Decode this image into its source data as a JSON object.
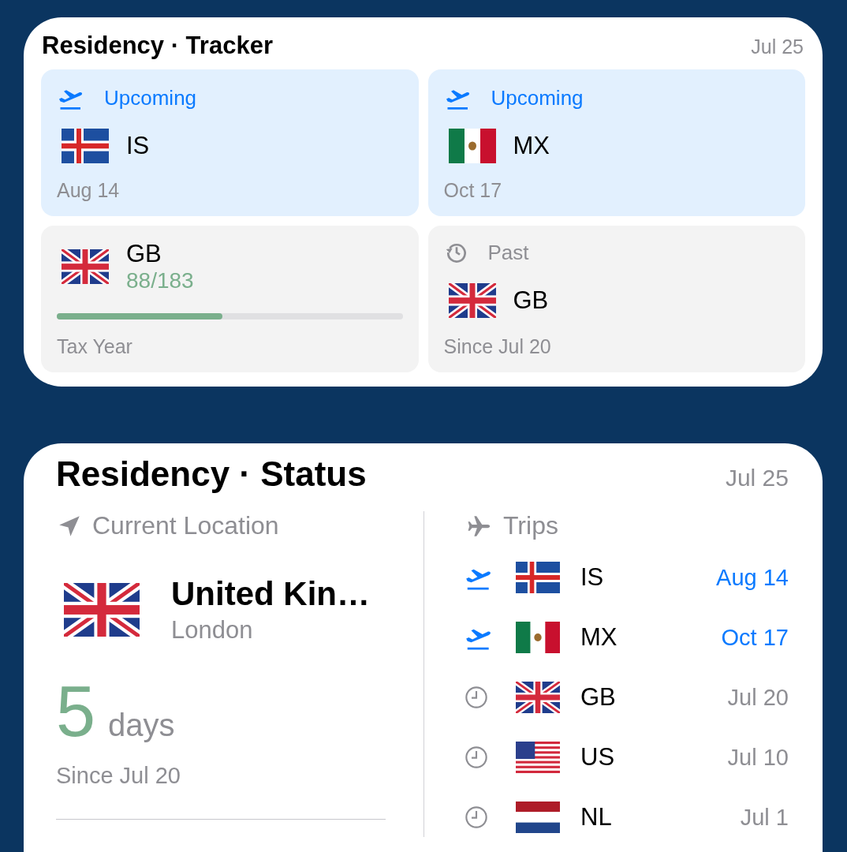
{
  "tracker": {
    "title": "Residency · Tracker",
    "date": "Jul 25",
    "tiles": [
      {
        "kind": "upcoming",
        "label": "Upcoming",
        "flag": {
          "kind": "is"
        },
        "code": "IS",
        "date": "Aug 14"
      },
      {
        "kind": "upcoming",
        "label": "Upcoming",
        "flag": {
          "kind": "mx"
        },
        "code": "MX",
        "date": "Oct 17"
      },
      {
        "kind": "progress",
        "flag": {
          "kind": "gb"
        },
        "code": "GB",
        "count": "88/183",
        "level": 0.48,
        "caption": "Tax Year"
      },
      {
        "kind": "past",
        "label": "Past",
        "flag": {
          "kind": "gb"
        },
        "code": "GB",
        "date": "Since Jul 20"
      }
    ]
  },
  "status": {
    "title": "Residency · Status",
    "date": "Jul 25",
    "location": {
      "heading": "Current Location",
      "flag": {
        "kind": "gb"
      },
      "country": "United Kin…",
      "city": "London",
      "days": "5",
      "unit": "days",
      "since": "Since Jul 20"
    },
    "trips": {
      "heading": "Trips",
      "rows": [
        {
          "kind": "upcoming",
          "flag": {
            "kind": "is"
          },
          "code": "IS",
          "date": "Aug 14"
        },
        {
          "kind": "upcoming",
          "flag": {
            "kind": "mx"
          },
          "code": "MX",
          "date": "Oct 17"
        },
        {
          "kind": "past",
          "flag": {
            "kind": "gb"
          },
          "code": "GB",
          "date": "Jul 20"
        },
        {
          "kind": "past",
          "flag": {
            "kind": "us"
          },
          "code": "US",
          "date": "Jul 10"
        },
        {
          "kind": "past",
          "flag": {
            "kind": "nl"
          },
          "code": "NL",
          "date": "Jul 1"
        }
      ]
    }
  }
}
